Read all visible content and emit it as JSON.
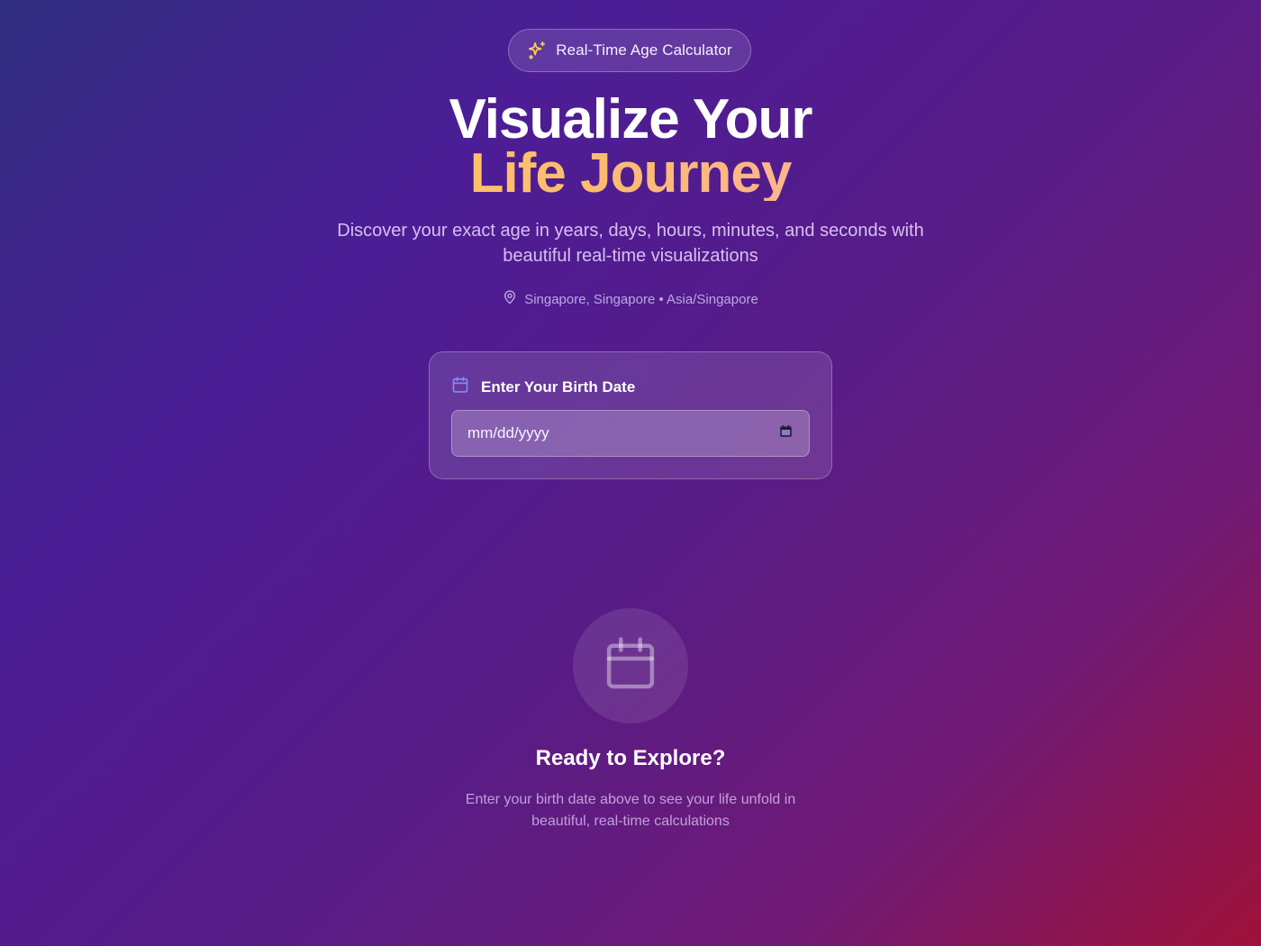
{
  "badge": {
    "icon": "sparkles-icon",
    "label": "Real-Time Age Calculator"
  },
  "hero": {
    "title_line1": "Visualize Your",
    "title_line2": "Life Journey",
    "subtitle": "Discover your exact age in years, days, hours, minutes, and seconds with beautiful real-time visualizations"
  },
  "location": {
    "icon": "map-pin-icon",
    "text": "Singapore, Singapore • Asia/Singapore"
  },
  "birth_date_card": {
    "icon": "calendar-icon",
    "title": "Enter Your Birth Date",
    "input_placeholder": "mm/dd/yyyy",
    "input_value": "",
    "picker_icon": "calendar-picker-icon"
  },
  "empty_state": {
    "icon": "calendar-icon",
    "title": "Ready to Explore?",
    "description": "Enter your birth date above to see your life unfold in beautiful, real-time calculations"
  },
  "colors": {
    "accent_yellow": "#fcd34d",
    "accent_indigo": "#6366f1",
    "background_start": "#312e81",
    "background_end": "#9f1239"
  }
}
